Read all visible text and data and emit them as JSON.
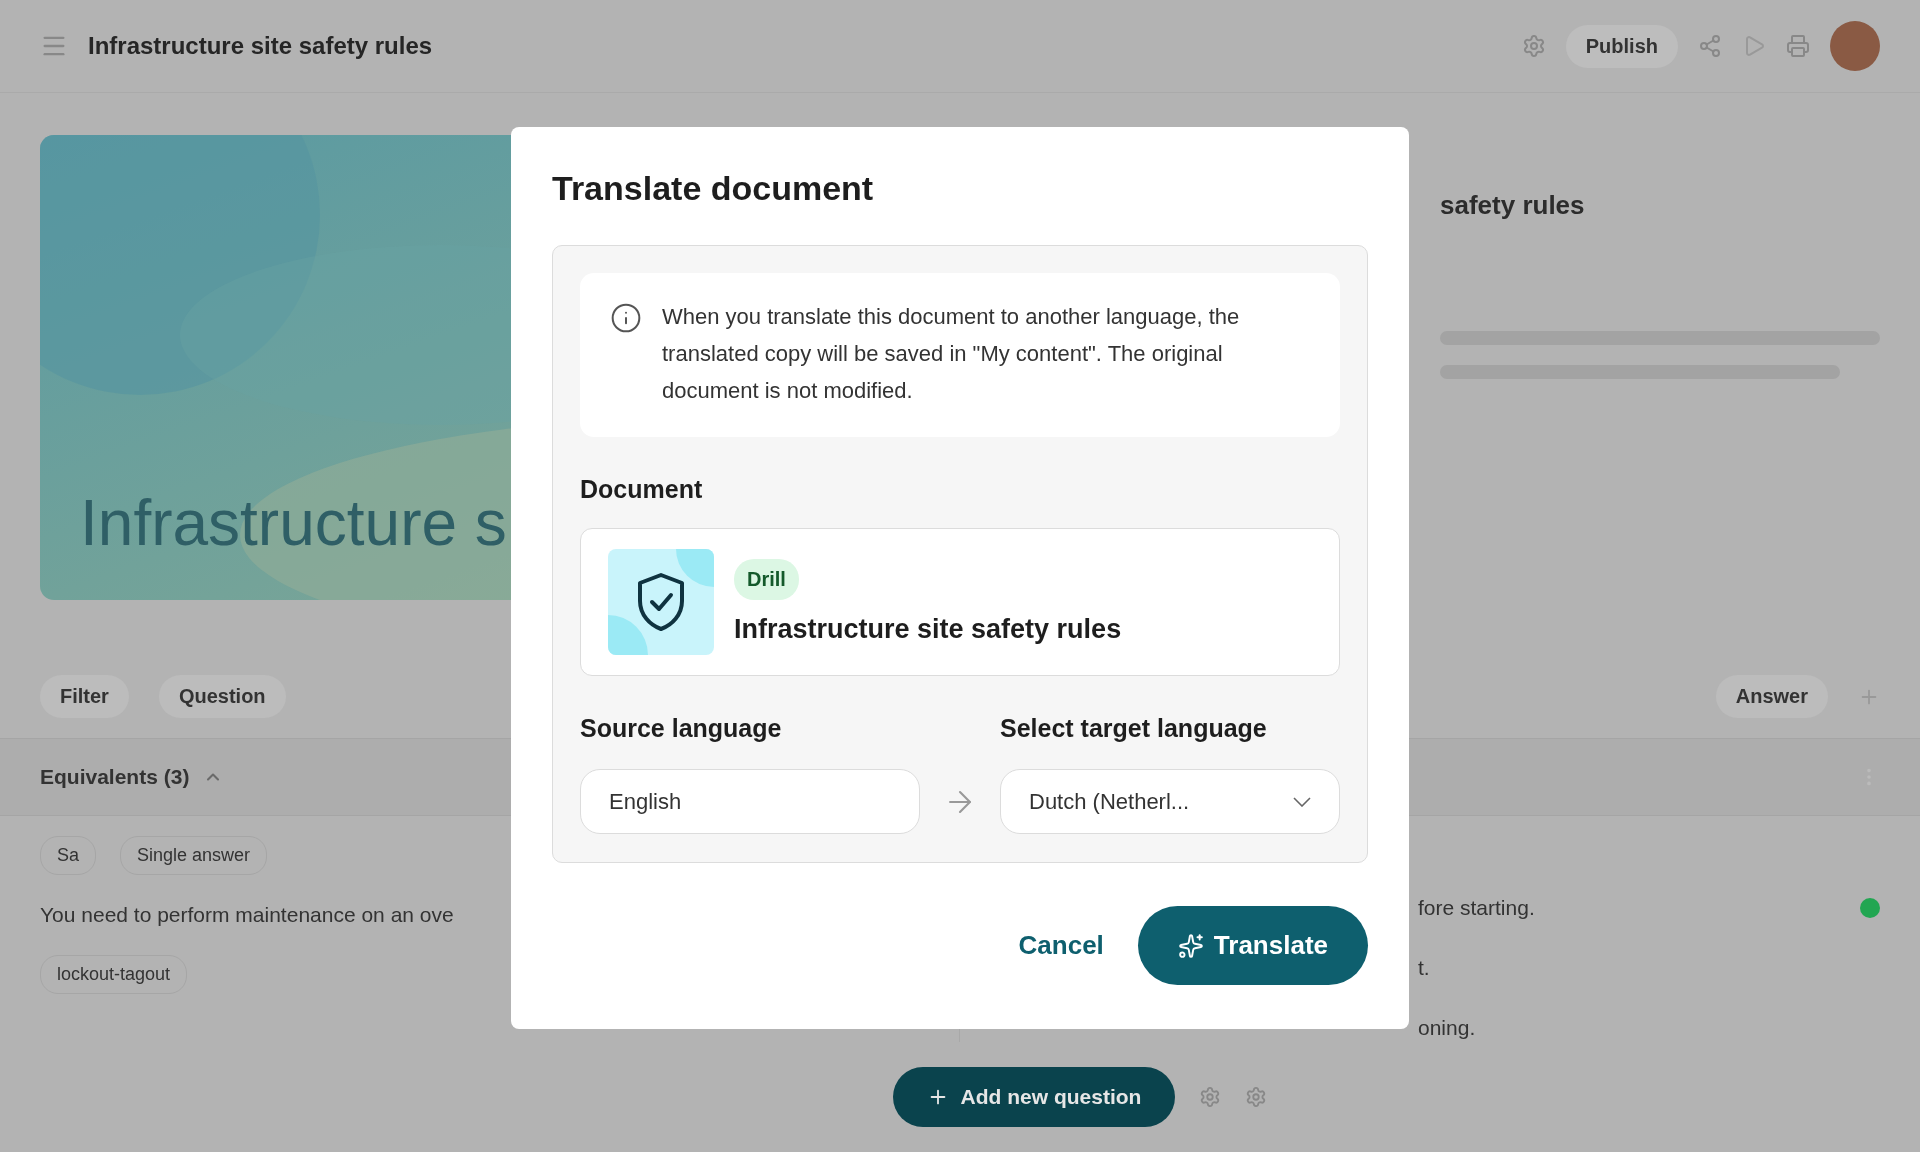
{
  "header": {
    "title": "Infrastructure site safety rules",
    "publish": "Publish"
  },
  "hero": {
    "kind": "picture",
    "title": "Infrastructure s"
  },
  "details": {
    "title": "safety rules"
  },
  "filters": [
    {
      "label": "Filter"
    },
    {
      "label": "Question"
    }
  ],
  "answer_filter": "Answer",
  "equivalents": "Equivalents (3)",
  "question": {
    "tags": [
      "Sa",
      "Single answer"
    ],
    "text": "You need to perform maintenance on an ove",
    "keyword": "lockout-tagout"
  },
  "answers": [
    {
      "text": "fore starting.",
      "color": "#22a652"
    },
    {
      "text": "t."
    },
    {
      "text": "oning."
    }
  ],
  "add_button": "Add new question",
  "dialog": {
    "title": "Translate document",
    "info": "When you translate this document to another language, the translated copy will be saved in \"My content\". The original document is not modified.",
    "document_label": "Document",
    "document": {
      "badge": "Drill",
      "title": "Infrastructure site safety rules"
    },
    "source_label": "Source language",
    "source_value": "English",
    "target_label": "Select target language",
    "target_value": "Dutch (Netherl...",
    "buttons": [
      {
        "kind": "link",
        "label": "Cancel"
      },
      {
        "kind": "primary",
        "label": "Translate"
      }
    ]
  }
}
